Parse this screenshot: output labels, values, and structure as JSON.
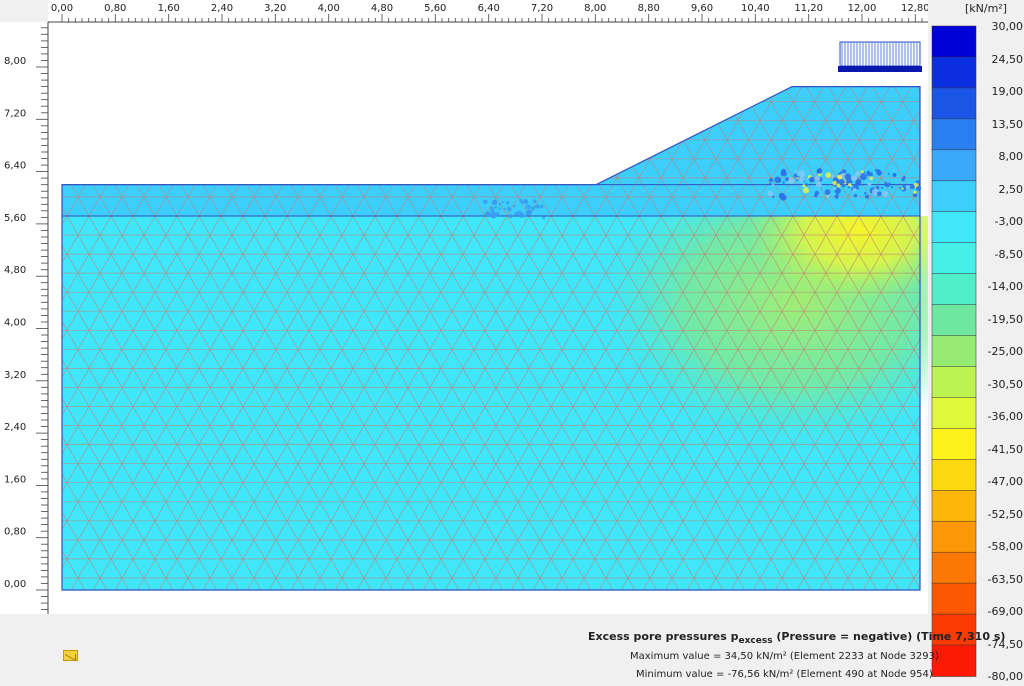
{
  "x_axis": {
    "tick_labels": [
      "0,00",
      "0,80",
      "1,60",
      "2,40",
      "3,20",
      "4,00",
      "4,80",
      "5,60",
      "6,40",
      "7,20",
      "8,00",
      "8,80",
      "9,60",
      "10,40",
      "11,20",
      "12,00",
      "12,80"
    ],
    "min": 0.0,
    "max": 13.12
  },
  "y_axis": {
    "tick_labels": [
      "0,00",
      "0,80",
      "1,60",
      "2,40",
      "3,20",
      "4,00",
      "4,80",
      "5,60",
      "6,40",
      "7,20",
      "8,00"
    ],
    "min": -0.3,
    "max": 8.6
  },
  "geometry": {
    "ground_level": 6.2,
    "layer_boundary": 5.72,
    "embankment_top": 7.7,
    "embankment_toe_x": 8.2,
    "embankment_crest_x": 11.2,
    "model_right_x": 13.12,
    "model_bottom": 0.0
  },
  "legend": {
    "unit": "[kN/m²]",
    "values": [
      "30,00",
      "24,50",
      "19,00",
      "13,50",
      "8,00",
      "2,50",
      "-3,00",
      "-8,50",
      "-14,00",
      "-19,50",
      "-25,00",
      "-30,50",
      "-36,00",
      "-41,50",
      "-47,00",
      "-52,50",
      "-58,00",
      "-63,50",
      "-69,00",
      "-74,50",
      "-80,00"
    ],
    "colors": [
      "#0000d8",
      "#0b2ee0",
      "#1a55e6",
      "#2a7ff0",
      "#3aa8f7",
      "#3ccffc",
      "#40e6fa",
      "#46f0e8",
      "#50eec8",
      "#6ee8a0",
      "#96ec72",
      "#bcf350",
      "#e0f83a",
      "#fcf31c",
      "#fcd810",
      "#fcb808",
      "#fc9806",
      "#fc7804",
      "#fc5804",
      "#fc3a04",
      "#fc1a04"
    ]
  },
  "info": {
    "title_prefix": "Excess pore pressures p",
    "title_sub": "excess",
    "title_suffix": " (Pressure = negative) (Time 7,310 s)",
    "max_value": "Maximum value = 34,50 kN/m² (Element 2233 at Node 3293)",
    "min_value": "Minimum value = -76,56 kN/m² (Element 490 at Node 954)"
  },
  "colors": {
    "background": "#ffffff",
    "mesh_line": "#c08070",
    "base_fill": "#40e6fa",
    "upper_fill": "#3ccffc",
    "outline": "#3050c0"
  }
}
